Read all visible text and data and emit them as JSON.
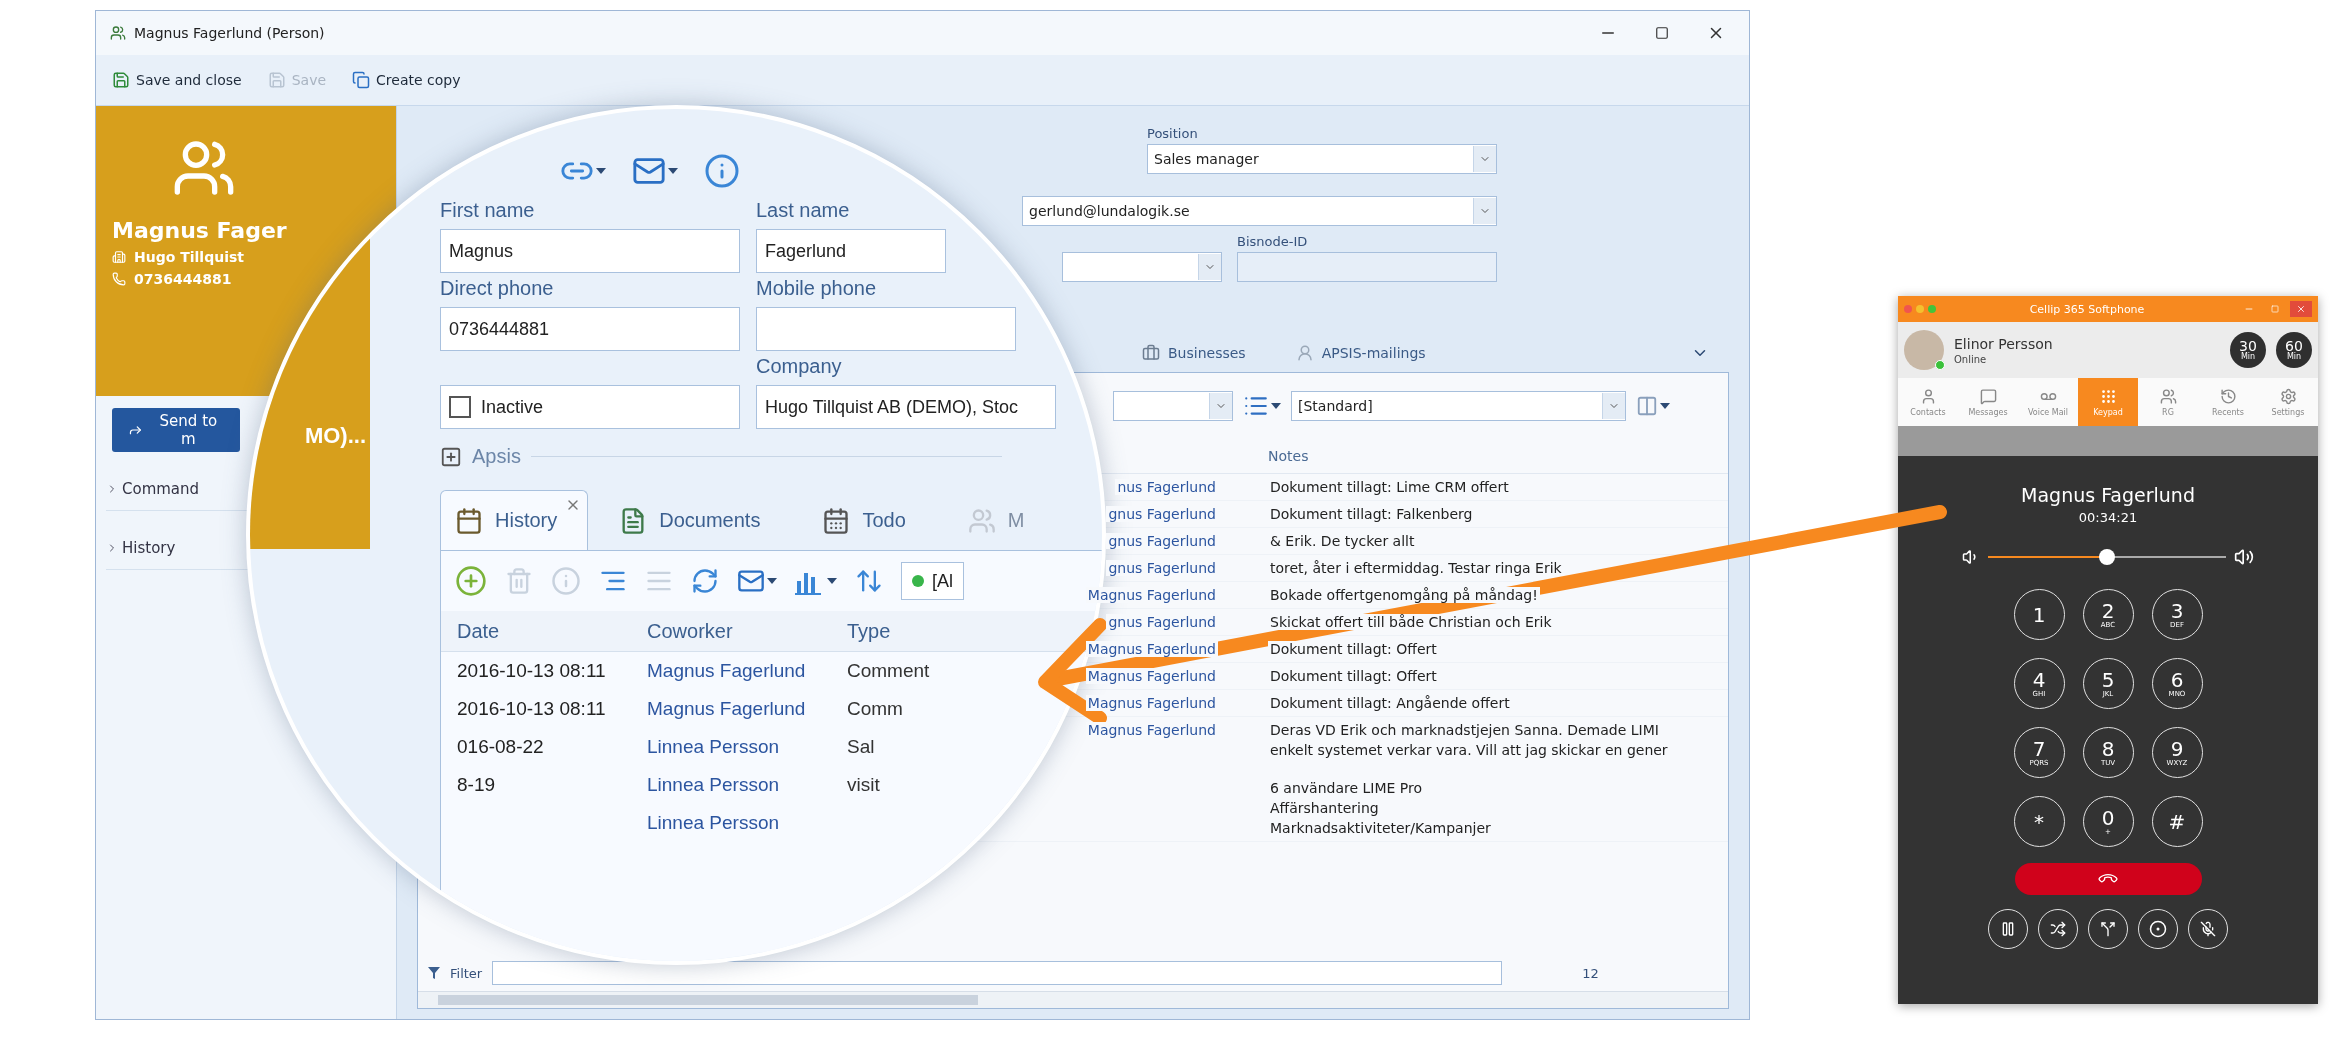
{
  "crm_window": {
    "title": "Magnus Fagerlund (Person)",
    "toolbar": [
      {
        "kind": "save",
        "label": "Save and close",
        "disabled": false
      },
      {
        "kind": "save",
        "label": "Save",
        "disabled": true
      },
      {
        "kind": "copy",
        "label": "Create copy",
        "disabled": false
      }
    ],
    "contact": {
      "name": "Magnus Fager",
      "company": "Hugo Tillquist",
      "phone": "0736444881"
    },
    "send_button": "Send to m",
    "nav": [
      {
        "label": "Command",
        "expanded": false
      },
      {
        "label": "History",
        "expanded": false
      }
    ],
    "fields": {
      "position_label": "Position",
      "position": "Sales manager",
      "email": "gerlund@lundalogik.se",
      "bisnode_label": "Bisnode-ID"
    },
    "tabs": [
      {
        "kind": "businesses",
        "label": "Businesses"
      },
      {
        "kind": "mailings",
        "label": "APSIS-mailings"
      }
    ],
    "view": "[Standard]",
    "table": {
      "columns": [
        "Notes"
      ],
      "rows": [
        {
          "coworker": "nus Fagerlund",
          "notes": [
            "Dokument tillagt: Lime CRM offert"
          ]
        },
        {
          "coworker": "gnus Fagerlund",
          "notes": [
            "Dokument tillagt: Falkenberg"
          ]
        },
        {
          "coworker": "gnus Fagerlund",
          "notes": [
            "& Erik. De tycker allt"
          ]
        },
        {
          "coworker": "gnus Fagerlund",
          "notes": [
            "toret, åter i eftermiddag. Testar ringa Erik"
          ]
        },
        {
          "coworker": "Magnus Fagerlund",
          "notes": [
            "Bokade offertgenomgång på måndag!"
          ]
        },
        {
          "coworker": "gnus Fagerlund",
          "notes": [
            "Skickat offert till både Christian och Erik"
          ]
        },
        {
          "coworker": "Magnus Fagerlund",
          "notes": [
            "Dokument tillagt: Offert"
          ]
        },
        {
          "coworker": "Magnus Fagerlund",
          "notes": [
            "Dokument tillagt: Offert"
          ]
        },
        {
          "coworker": "Magnus Fagerlund",
          "notes": [
            "Dokument tillagt: Angående offert"
          ]
        },
        {
          "coworker": "Magnus Fagerlund",
          "notes": [
            "Deras VD Erik och marknadstjejen Sanna. Demade LIMI",
            "enkelt systemet verkar vara. Vill att jag skickar en gener",
            "6 användare LIME Pro",
            "Affärshantering",
            "Marknadsaktiviteter/Kampanjer"
          ]
        }
      ]
    },
    "filter": {
      "label": "Filter",
      "count": "12"
    }
  },
  "magnifier": {
    "sidebar_text": "MO)...",
    "form": {
      "first_name": {
        "label": "First name",
        "value": "Magnus"
      },
      "last_name": {
        "label": "Last name",
        "value": "Fagerlund"
      },
      "direct_phone": {
        "label": "Direct phone",
        "value": "0736444881"
      },
      "mobile_phone": {
        "label": "Mobile phone"
      },
      "company": {
        "label": "Company",
        "value": "Hugo Tillquist AB (DEMO), Stoc"
      },
      "inactive": {
        "label": "Inactive",
        "checked": false
      }
    },
    "apsis": {
      "label": "Apsis",
      "expanded": false
    },
    "tabs": [
      {
        "kind": "history",
        "label": "History",
        "selected": true
      },
      {
        "kind": "documents",
        "label": "Documents",
        "selected": false
      },
      {
        "kind": "todo",
        "label": "Todo",
        "selected": false
      },
      {
        "kind": "group",
        "label": "M",
        "selected": false
      }
    ],
    "filter_combo": "[Al",
    "table": {
      "columns": [
        "Date",
        "Coworker",
        "Type"
      ],
      "rows": [
        {
          "date": "2016-10-13 08:11",
          "coworker": "Magnus Fagerlund",
          "type": "Comment"
        },
        {
          "date": "2016-10-13 08:11",
          "coworker": "Magnus Fagerlund",
          "type": "Comm"
        },
        {
          "date": "016-08-22",
          "coworker": "Linnea Persson",
          "type": "Sal"
        },
        {
          "date": "8-19",
          "coworker": "Linnea Persson",
          "type": "visit"
        },
        {
          "coworker": "Linnea Persson"
        }
      ]
    }
  },
  "softphone": {
    "title": "Cellip 365 Softphone",
    "user": {
      "name": "Elinor Persson",
      "status": "Online"
    },
    "counters": [
      {
        "value": "30",
        "unit": "Min"
      },
      {
        "value": "60",
        "unit": "Min"
      }
    ],
    "nav": [
      {
        "kind": "contacts",
        "label": "Contacts",
        "selected": false
      },
      {
        "kind": "messages",
        "label": "Messages",
        "selected": false
      },
      {
        "kind": "voicemail",
        "label": "Voice Mail",
        "selected": false
      },
      {
        "kind": "keypad",
        "label": "Keypad",
        "selected": true
      },
      {
        "kind": "groups",
        "label": "RG",
        "selected": false
      },
      {
        "kind": "recents",
        "label": "Recents",
        "selected": false
      },
      {
        "kind": "settings",
        "label": "Settings",
        "selected": false
      }
    ],
    "call": {
      "name": "Magnus Fagerlund",
      "duration": "00:34:21",
      "volume": {
        "level": 0.5
      }
    },
    "keys": [
      {
        "digit": "1"
      },
      {
        "digit": "2",
        "letters": "ABC"
      },
      {
        "digit": "3",
        "letters": "DEF"
      },
      {
        "digit": "4",
        "letters": "GHI"
      },
      {
        "digit": "5",
        "letters": "JKL"
      },
      {
        "digit": "6",
        "letters": "MNO"
      },
      {
        "digit": "7",
        "letters": "PQRS"
      },
      {
        "digit": "8",
        "letters": "TUV"
      },
      {
        "digit": "9",
        "letters": "WXYZ"
      },
      {
        "digit": "*"
      },
      {
        "digit": "0",
        "letters": "+"
      },
      {
        "digit": "#"
      }
    ]
  }
}
